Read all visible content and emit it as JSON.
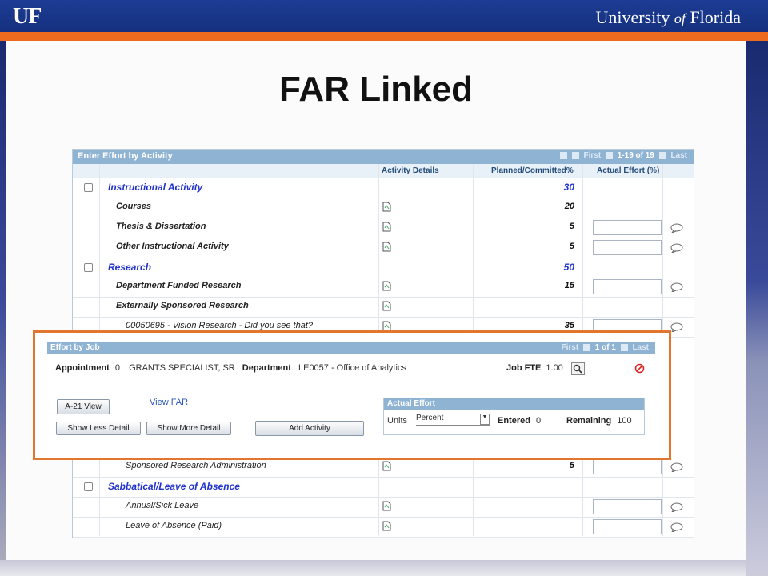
{
  "header": {
    "logo": "UF",
    "university_prefix": "University ",
    "university_of": "of",
    "university_suffix": " Florida"
  },
  "slide_title": "FAR Linked",
  "grid": {
    "title": "Enter Effort by Activity",
    "nav": {
      "first": "First",
      "range": "1-19 of 19",
      "last": "Last"
    },
    "col_activity_details": "Activity Details",
    "col_planned": "Planned/Committed%",
    "col_actual": "Actual Effort (%)",
    "rows": [
      {
        "label": "Instructional Activity",
        "value": "30"
      },
      {
        "label": "Courses",
        "value": "20"
      },
      {
        "label": "Thesis & Dissertation",
        "value": "5"
      },
      {
        "label": "Other Instructional Activity",
        "value": "5"
      },
      {
        "label": "Research",
        "value": "50"
      },
      {
        "label": "Department Funded Research",
        "value": "15"
      },
      {
        "label": "Externally Sponsored Research",
        "value": ""
      },
      {
        "label": "00050695 - Vision Research - Did you see that?",
        "value": "35"
      },
      {
        "label": "Sponsored Research Administration",
        "value": "5"
      },
      {
        "label": "Sabbatical/Leave of Absence",
        "value": ""
      },
      {
        "label": "Annual/Sick Leave",
        "value": ""
      },
      {
        "label": "Leave of Absence (Paid)",
        "value": ""
      }
    ]
  },
  "popup": {
    "title": "Effort by Job",
    "nav": {
      "first": "First",
      "range": "1 of 1",
      "last": "Last"
    },
    "appointment_label": "Appointment",
    "appointment_value": "0",
    "job_title": "GRANTS SPECIALIST, SR",
    "department_label": "Department",
    "department_value": "LE0057 - Office of Analytics",
    "job_fte_label": "Job FTE",
    "job_fte_value": "1.00",
    "a21_button": "A-21 View",
    "view_far_link": "View FAR",
    "show_less": "Show Less Detail",
    "show_more": "Show More Detail",
    "add_activity": "Add Activity",
    "actual_effort_title": "Actual Effort",
    "units_label": "Units",
    "units_value": "Percent",
    "entered_label": "Entered",
    "entered_value": "0",
    "remaining_label": "Remaining",
    "remaining_value": "100"
  },
  "colors": {
    "accent": "#ec6b1f",
    "header_blue": "#1c3c94",
    "grid_head": "#8fb3d3",
    "category_text": "#2233cc"
  }
}
